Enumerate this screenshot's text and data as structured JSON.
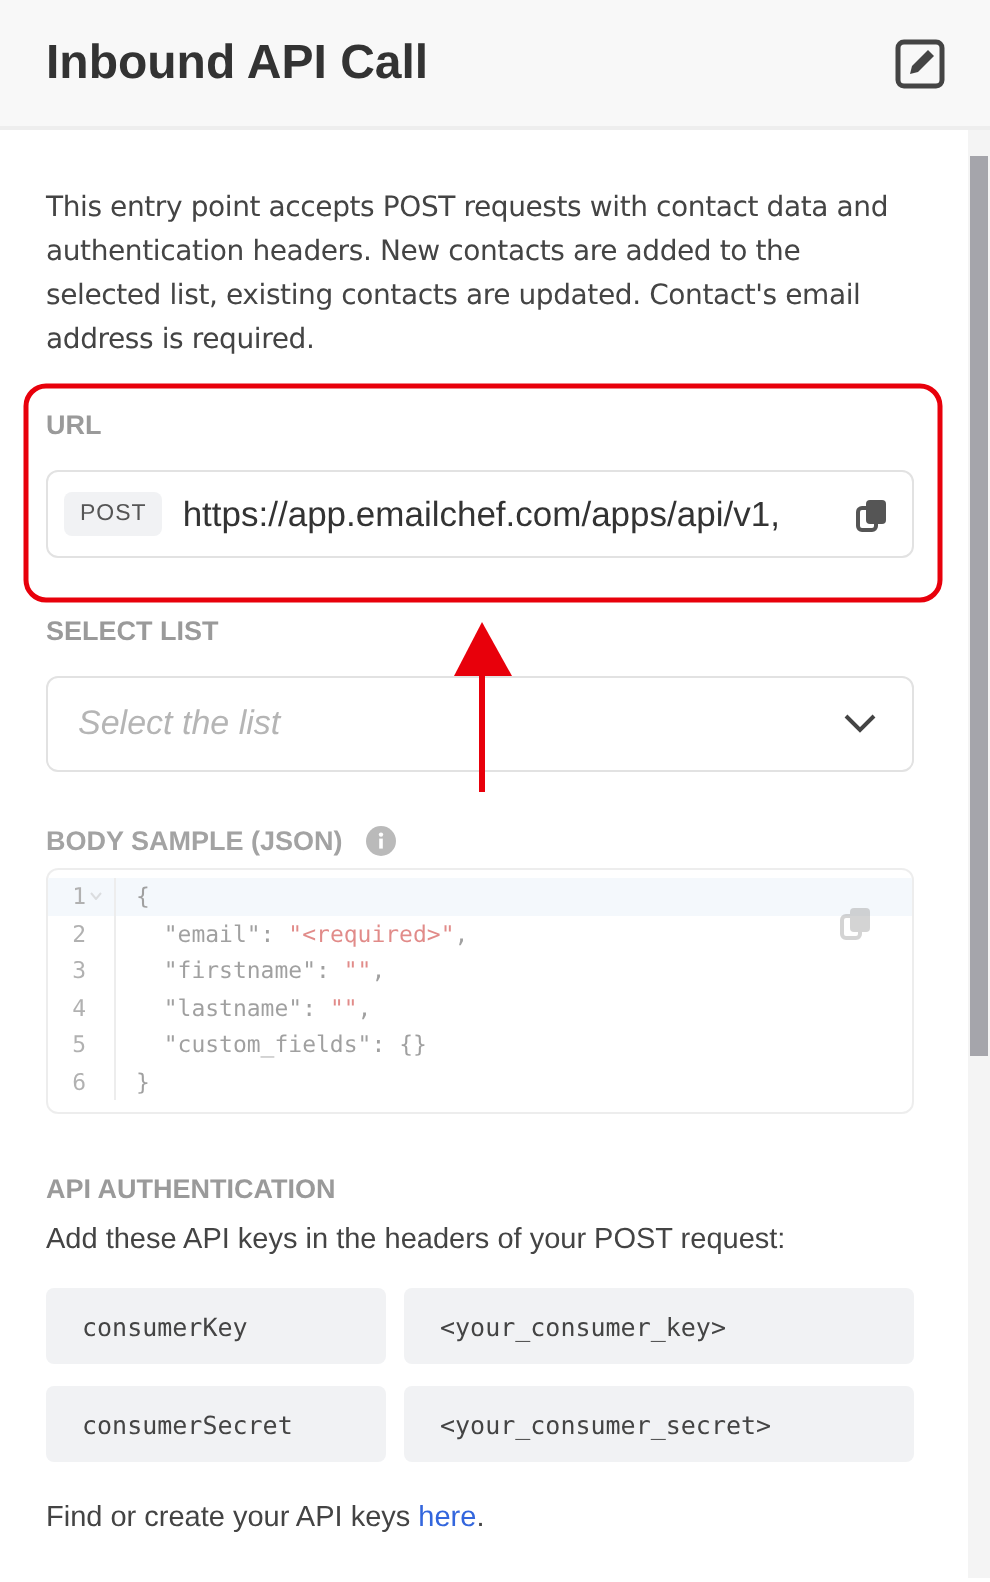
{
  "header": {
    "title": "Inbound API Call"
  },
  "description": "This entry point accepts POST requests with contact data and authentication headers. New contacts are added to the selected list, existing contacts are updated. Contact's email address is required.",
  "url": {
    "label": "URL",
    "method": "POST",
    "value": "https://app.emailchef.com/apps/api/v1,"
  },
  "select_list": {
    "label": "SELECT LIST",
    "placeholder": "Select the list"
  },
  "body_sample": {
    "label": "BODY SAMPLE (JSON)",
    "disabled": true,
    "lines": [
      {
        "number": "1",
        "foldable": true,
        "active": true,
        "tokens": [
          {
            "kind": "punct",
            "text": "{"
          }
        ]
      },
      {
        "number": "2",
        "foldable": false,
        "active": false,
        "tokens": [
          {
            "kind": "key",
            "text": "  \"email\": "
          },
          {
            "kind": "string",
            "text": "\"<required>\""
          },
          {
            "kind": "punct",
            "text": ","
          }
        ]
      },
      {
        "number": "3",
        "foldable": false,
        "active": false,
        "tokens": [
          {
            "kind": "key",
            "text": "  \"firstname\": "
          },
          {
            "kind": "string",
            "text": "\"\""
          },
          {
            "kind": "punct",
            "text": ","
          }
        ]
      },
      {
        "number": "4",
        "foldable": false,
        "active": false,
        "tokens": [
          {
            "kind": "key",
            "text": "  \"lastname\": "
          },
          {
            "kind": "string",
            "text": "\"\""
          },
          {
            "kind": "punct",
            "text": ","
          }
        ]
      },
      {
        "number": "5",
        "foldable": false,
        "active": false,
        "tokens": [
          {
            "kind": "key",
            "text": "  \"custom_fields\": "
          },
          {
            "kind": "punct",
            "text": "{}"
          }
        ]
      },
      {
        "number": "6",
        "foldable": false,
        "active": false,
        "tokens": [
          {
            "kind": "punct",
            "text": "}"
          }
        ]
      }
    ]
  },
  "api_authentication": {
    "label": "API AUTHENTICATION",
    "instruction": "Add these API keys in the headers of your POST request:",
    "keys": [
      {
        "name": "consumerKey",
        "value": "<your_consumer_key>"
      },
      {
        "name": "consumerSecret",
        "value": "<your_consumer_secret>"
      }
    ],
    "footer": "Find or create your API keys ",
    "link": "here",
    "footer_end": "."
  }
}
